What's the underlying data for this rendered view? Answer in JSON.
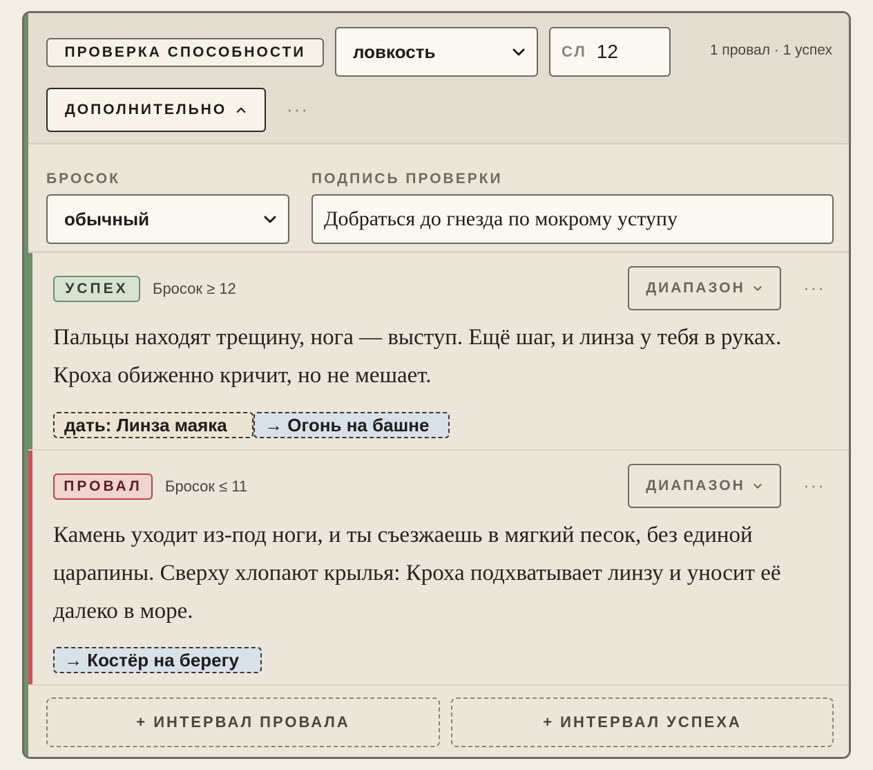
{
  "header": {
    "check_type_label": "ПРОВЕРКА СПОСОБНОСТИ",
    "ability_value": "ловкость",
    "dc_label": "СЛ",
    "dc_value": "12",
    "summary": "1 провал · 1 успех",
    "advanced_label": "ДОПОЛНИТЕЛЬНО",
    "more_label": "···"
  },
  "settings": {
    "roll_label": "БРОСОК",
    "roll_value": "обычный",
    "caption_label": "ПОДПИСЬ ПРОВЕРКИ",
    "caption_value": "Добраться до гнезда по мокрому уступу"
  },
  "outcomes": [
    {
      "badge": "УСПЕХ",
      "condition": "Бросок ≥ 12",
      "range_label": "ДИАПАЗОН",
      "more_label": "···",
      "text": "Пальцы находят трещину, нога — выступ. Ещё шаг, и линза у тебя в руках. Кроха обиженно кричит, но не мешает.",
      "tags": [
        "дать: Линза маяка",
        "→ Огонь на башне"
      ]
    },
    {
      "badge": "ПРОВАЛ",
      "condition": "Бросок ≤ 11",
      "range_label": "ДИАПАЗОН",
      "more_label": "···",
      "text": "Камень уходит из-под ноги, и ты съезжаешь в мягкий песок, без единой царапины. Сверху хлопают крылья: Кроха подхватывает линзу и уносит её далеко в море.",
      "tags": [
        "→ Костёр на берегу"
      ]
    }
  ],
  "footer": {
    "add_fail_label": "+ ИНТЕРВАЛ ПРОВАЛА",
    "add_success_label": "+ ИНТЕРВАЛ УСПЕХА"
  },
  "colors": {
    "success_accent": "#6f8f69",
    "fail_accent": "#c8545a",
    "link_tag_bg": "#d8e0e8"
  }
}
